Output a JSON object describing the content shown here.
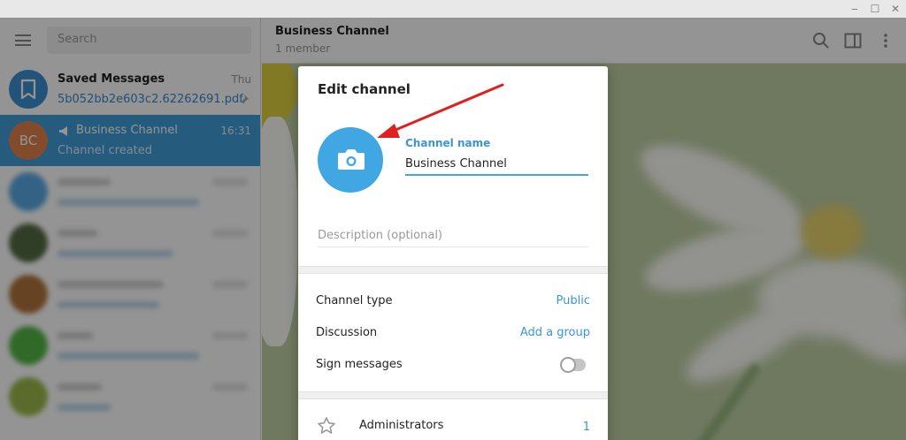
{
  "window": {
    "minimize": "‒",
    "maximize": "☐",
    "close": "✕"
  },
  "sidebar": {
    "search_placeholder": "Search",
    "chats": [
      {
        "name": "Saved Messages",
        "time": "Thu",
        "preview": "5b052bb2e603c2.62262691.pdf",
        "avatar_color": "#3e8fd0",
        "icon": "bookmark-icon",
        "pinned": true
      },
      {
        "name": "Business Channel",
        "time": "16:31",
        "preview": "Channel created",
        "initials": "BC",
        "avatar_color": "#e0824c",
        "icon": "megaphone-icon",
        "active": true
      }
    ],
    "blurred_avatar_colors": [
      "#5aa9e6",
      "#556b44",
      "#b0743c",
      "#55b548",
      "#9db94a"
    ]
  },
  "header": {
    "title": "Business Channel",
    "members": "1 member",
    "icons": [
      "search-icon",
      "sidebar-toggle-icon",
      "more-vertical-icon"
    ]
  },
  "dialog": {
    "title": "Edit channel",
    "photo_icon": "camera-icon",
    "channel_name_label": "Channel name",
    "channel_name_value": "Business Channel",
    "description_placeholder": "Description (optional)",
    "rows": [
      {
        "label": "Channel type",
        "value": "Public"
      },
      {
        "label": "Discussion",
        "value": "Add a group"
      },
      {
        "label": "Sign messages",
        "toggle": false
      }
    ],
    "administrators": {
      "label": "Administrators",
      "count": "1",
      "icon": "star-icon"
    }
  },
  "colors": {
    "accent": "#40a7e3",
    "link": "#3a95d5",
    "active_chat": "#419fd9",
    "annotation_arrow": "#e02020"
  }
}
